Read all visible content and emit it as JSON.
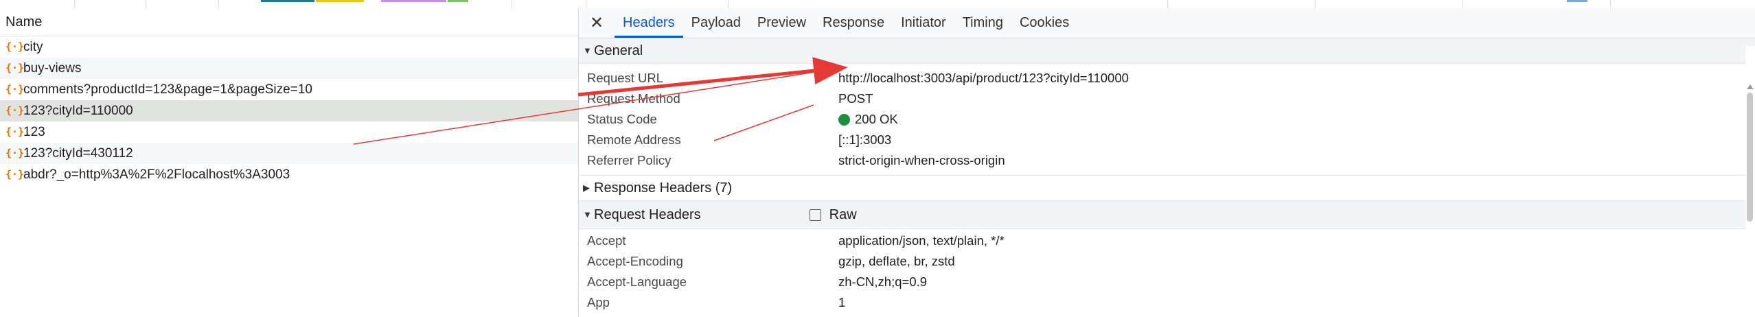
{
  "network_list": {
    "column_header": "Name",
    "rows": [
      {
        "name": "city"
      },
      {
        "name": "buy-views"
      },
      {
        "name": "comments?productId=123&page=1&pageSize=10"
      },
      {
        "name": "123?cityId=110000"
      },
      {
        "name": "123"
      },
      {
        "name": "123?cityId=430112"
      },
      {
        "name": "abdr?_o=http%3A%2F%2Flocalhost%3A3003"
      }
    ],
    "selected_index": 3,
    "row_icon": "json-braces-icon"
  },
  "details": {
    "close_icon": "close-icon",
    "tabs": [
      "Headers",
      "Payload",
      "Preview",
      "Response",
      "Initiator",
      "Timing",
      "Cookies"
    ],
    "active_tab": "Headers",
    "general": {
      "title": "General",
      "rows": [
        {
          "key": "Request URL",
          "value": "http://localhost:3003/api/product/123?cityId=110000"
        },
        {
          "key": "Request Method",
          "value": "POST"
        },
        {
          "key": "Status Code",
          "value": "200 OK"
        },
        {
          "key": "Remote Address",
          "value": "[::1]:3003"
        },
        {
          "key": "Referrer Policy",
          "value": "strict-origin-when-cross-origin"
        }
      ]
    },
    "response_headers": {
      "title": "Response Headers (7)"
    },
    "request_headers": {
      "title": "Request Headers",
      "raw_label": "Raw",
      "rows": [
        {
          "key": "Accept",
          "value": "application/json, text/plain, */*"
        },
        {
          "key": "Accept-Encoding",
          "value": "gzip, deflate, br, zstd"
        },
        {
          "key": "Accept-Language",
          "value": "zh-CN,zh;q=0.9"
        },
        {
          "key": "App",
          "value": "1"
        }
      ]
    }
  },
  "colors": {
    "annotation_arrow": "#e53935",
    "status_ok": "#1e8e3e",
    "accent": "#0b57d0"
  }
}
